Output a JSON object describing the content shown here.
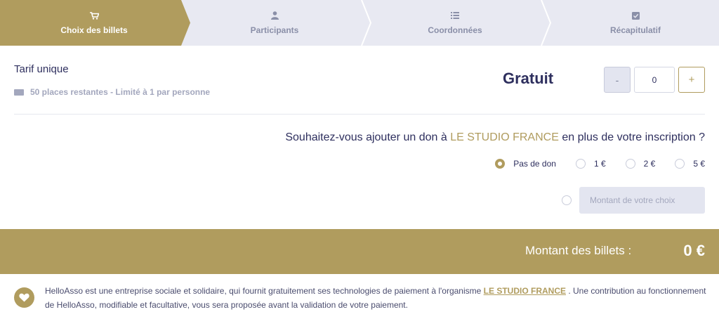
{
  "stepper": {
    "active_color": "#b09c5e",
    "inactive_color": "#e8e9f2",
    "steps": [
      {
        "label": "Choix des billets",
        "icon": "cart-icon",
        "active": true
      },
      {
        "label": "Participants",
        "icon": "user-icon",
        "active": false
      },
      {
        "label": "Coordonnées",
        "icon": "list-icon",
        "active": false
      },
      {
        "label": "Récapitulatif",
        "icon": "check-square-icon",
        "active": false
      }
    ]
  },
  "ticket": {
    "name": "Tarif unique",
    "info": "50 places restantes - Limité à 1 par personne",
    "price": "Gratuit",
    "minus_label": "-",
    "quantity": "0",
    "plus_label": "+"
  },
  "donation": {
    "question_prefix": "Souhaitez-vous ajouter un don à",
    "organization": "LE STUDIO FRANCE",
    "question_suffix": "en plus de votre inscription ?",
    "options": [
      {
        "label": "Pas de don",
        "checked": true
      },
      {
        "label": "1 €",
        "checked": false
      },
      {
        "label": "2 €",
        "checked": false
      },
      {
        "label": "5 €",
        "checked": false
      }
    ],
    "custom_placeholder": "Montant de votre choix"
  },
  "total": {
    "label": "Montant des billets :",
    "value": "0 €"
  },
  "footer": {
    "icon": "heart-icon",
    "text_before": "HelloAsso est une entreprise sociale et solidaire, qui fournit gratuitement ses technologies de paiement à l'organisme",
    "organization": "LE STUDIO FRANCE",
    "text_after": ". Une contribution au fonctionnement de HelloAsso, modifiable et facultative, vous sera proposée avant la validation de votre paiement."
  },
  "colors": {
    "brand": "#b09c5e",
    "text": "#2e2f5e",
    "muted": "#a3a7bd"
  }
}
